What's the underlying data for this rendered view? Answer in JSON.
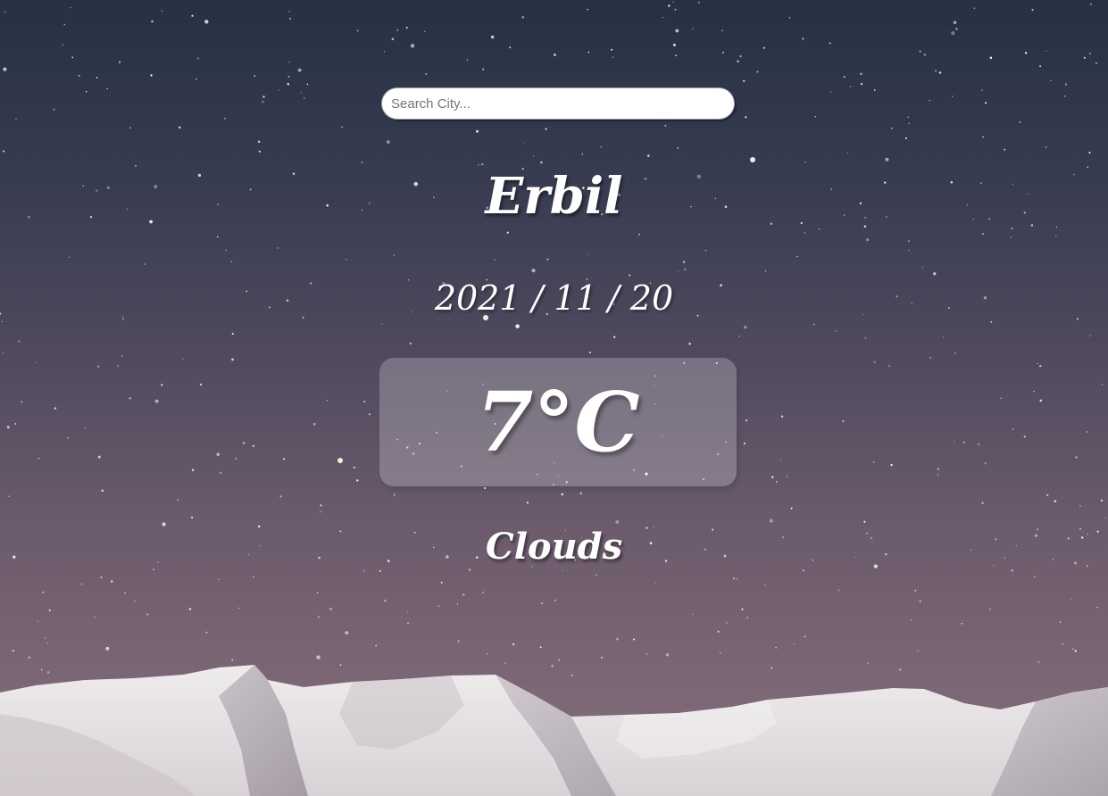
{
  "search": {
    "placeholder": "Search City...",
    "value": ""
  },
  "weather": {
    "city": "Erbil",
    "date": "2021 / 11 / 20",
    "temperature": "7°C",
    "condition": "Clouds"
  },
  "colors": {
    "text": "#ffffff",
    "sky_top": "#263142",
    "sky_bottom": "#857079",
    "temp_box": "rgba(255,255,255,0.22)",
    "snow": "#e9e6e8"
  }
}
